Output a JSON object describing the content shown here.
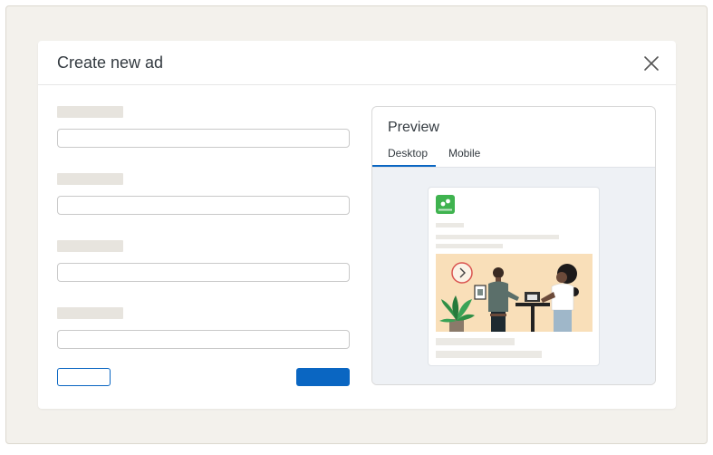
{
  "modal": {
    "title": "Create new ad"
  },
  "preview": {
    "title": "Preview",
    "tabs": [
      {
        "label": "Desktop",
        "active": true
      },
      {
        "label": "Mobile",
        "active": false
      }
    ]
  },
  "icons": {
    "close": "close-icon",
    "brand_logo": "brand-logo-icon"
  },
  "colors": {
    "accent": "#0a66c2",
    "brand_green": "#3fb34f",
    "illustration_bg": "#f9dfb9",
    "backdrop": "#f3f1ec"
  }
}
